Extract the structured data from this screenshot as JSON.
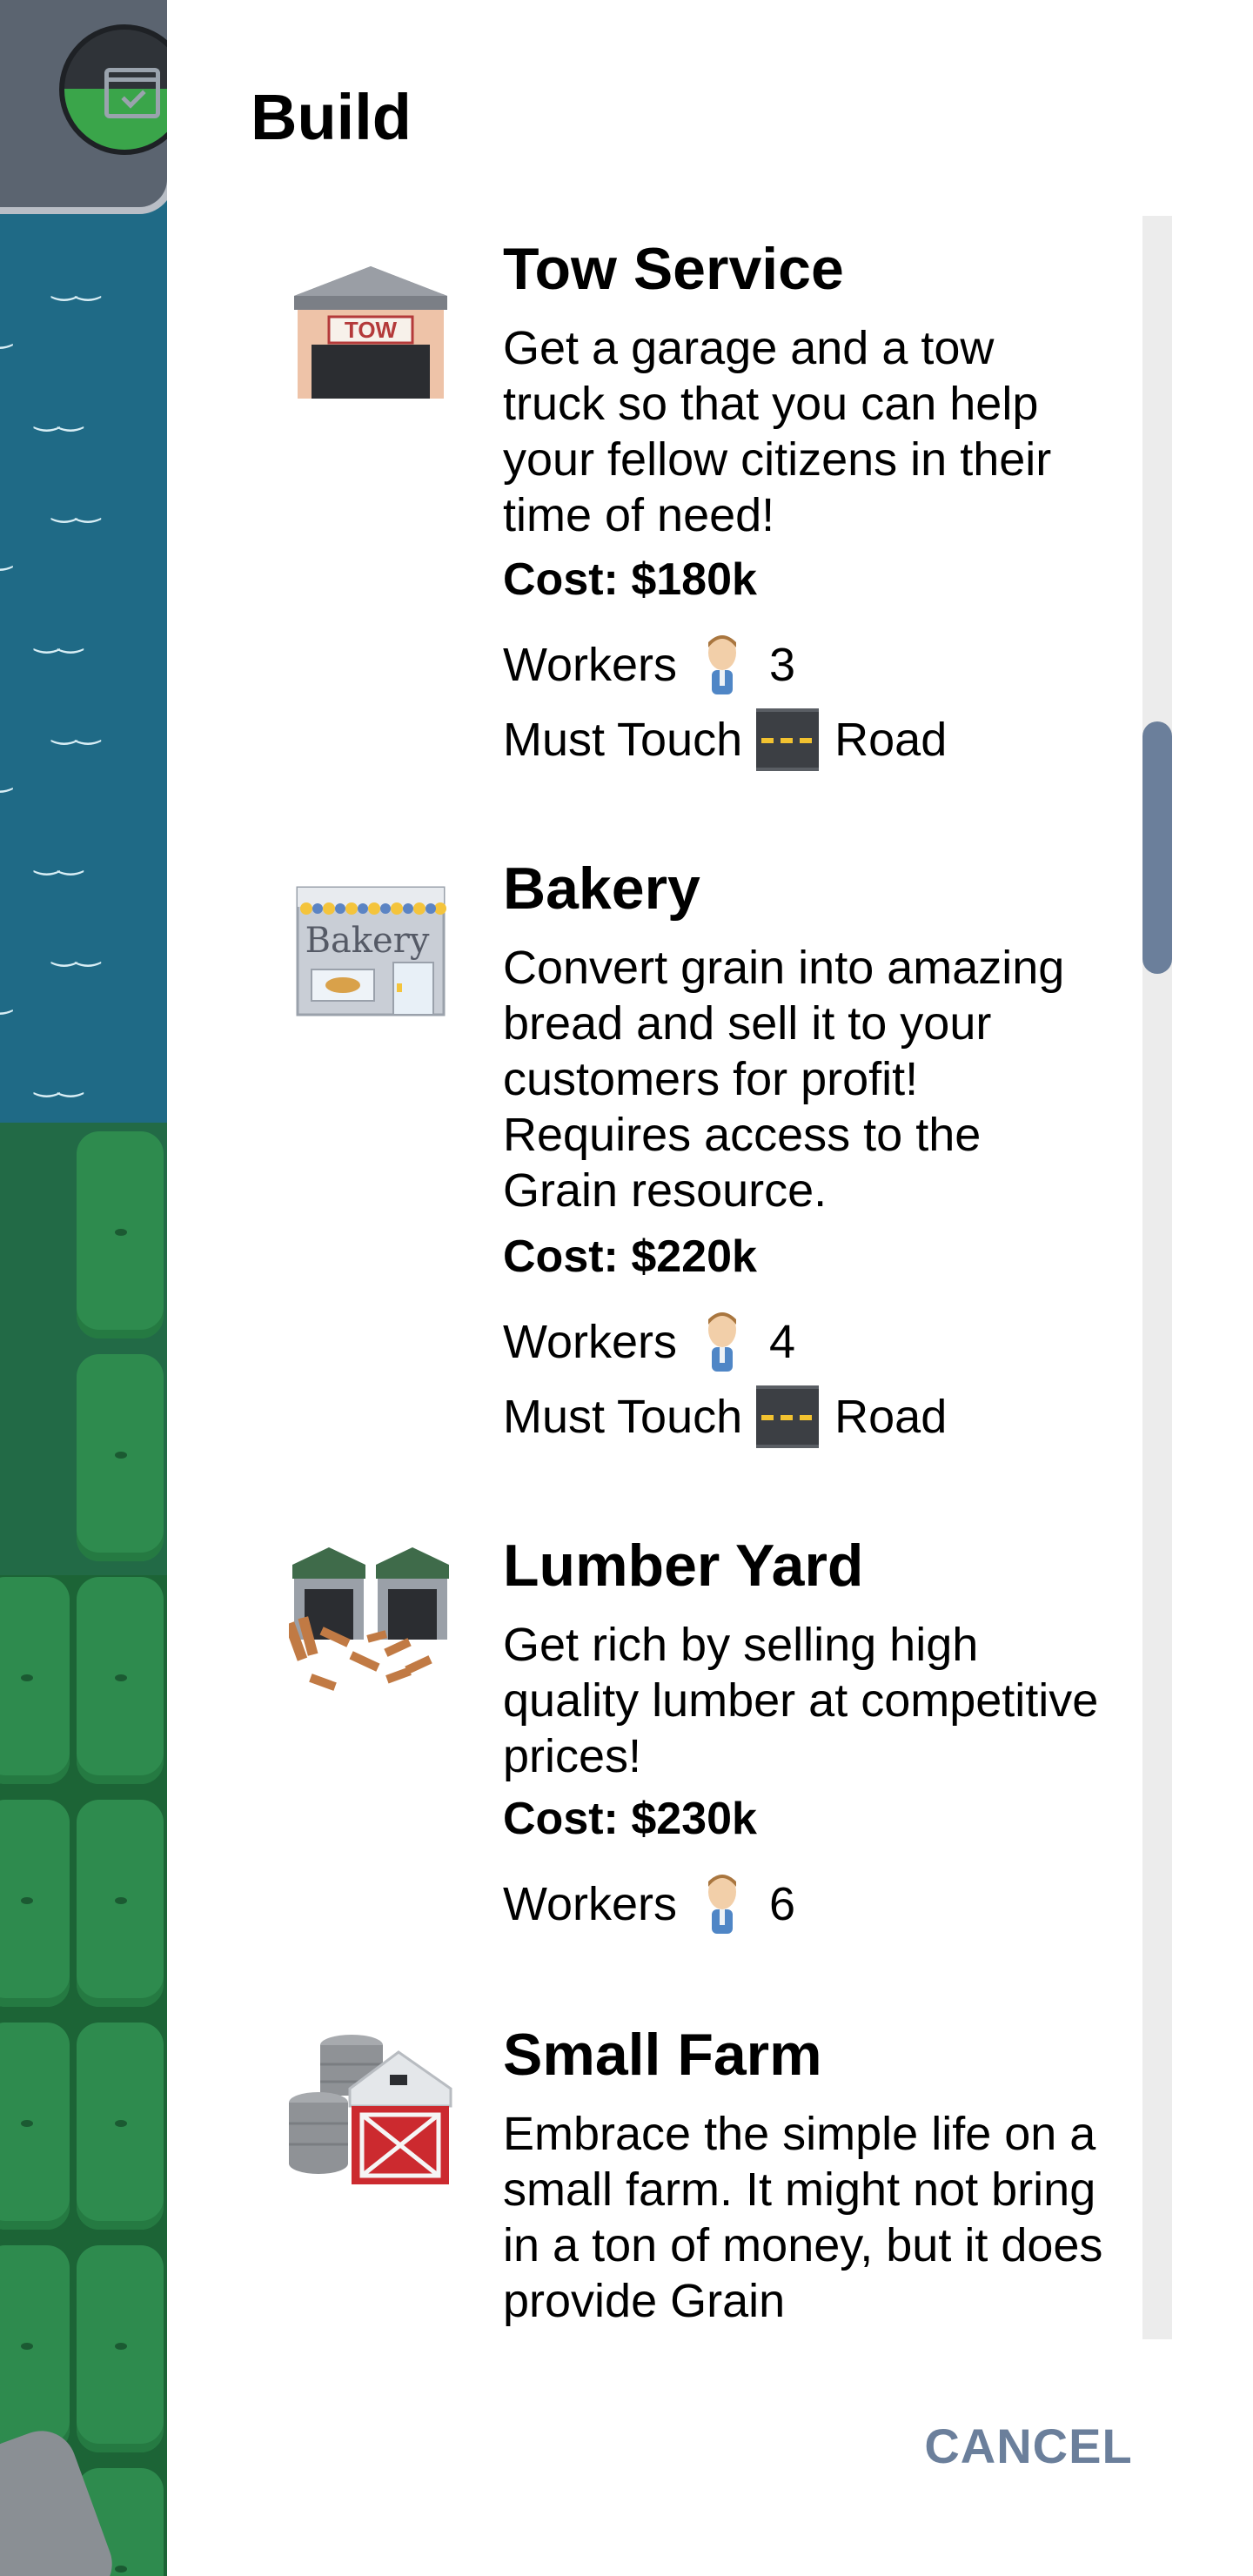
{
  "panel": {
    "title": "Build"
  },
  "items": [
    {
      "name": "Tow Service",
      "description": "Get a garage and a tow truck so that you can help your fellow citizens in their time of need!",
      "cost": "Cost: $180k",
      "workers_label": "Workers",
      "workers": "3",
      "touch_label": "Must Touch",
      "touch_target": "Road",
      "sign_text": "TOW",
      "icon": "tow-garage-icon"
    },
    {
      "name": "Bakery",
      "description": "Convert grain into amazing bread and sell it to your customers for profit! Requires access to the Grain resource.",
      "cost": "Cost: $220k",
      "workers_label": "Workers",
      "workers": "4",
      "touch_label": "Must Touch",
      "touch_target": "Road",
      "sign_text": "Bakery",
      "icon": "bakery-icon"
    },
    {
      "name": "Lumber Yard",
      "description": "Get rich by selling high quality lumber at competitive prices!",
      "cost": "Cost: $230k",
      "workers_label": "Workers",
      "workers": "6",
      "icon": "lumber-yard-icon"
    },
    {
      "name": "Small Farm",
      "description": "Embrace the simple life on a small farm. It might not bring in a ton of money, but it does provide Grain",
      "icon": "farm-barn-icon"
    }
  ],
  "actions": {
    "cancel": "CANCEL"
  },
  "colors": {
    "accent": "#6b7f9b",
    "water": "#1f6a86",
    "grass": "#2e8b4e"
  },
  "scroll": {
    "position_fraction": 0.27
  }
}
